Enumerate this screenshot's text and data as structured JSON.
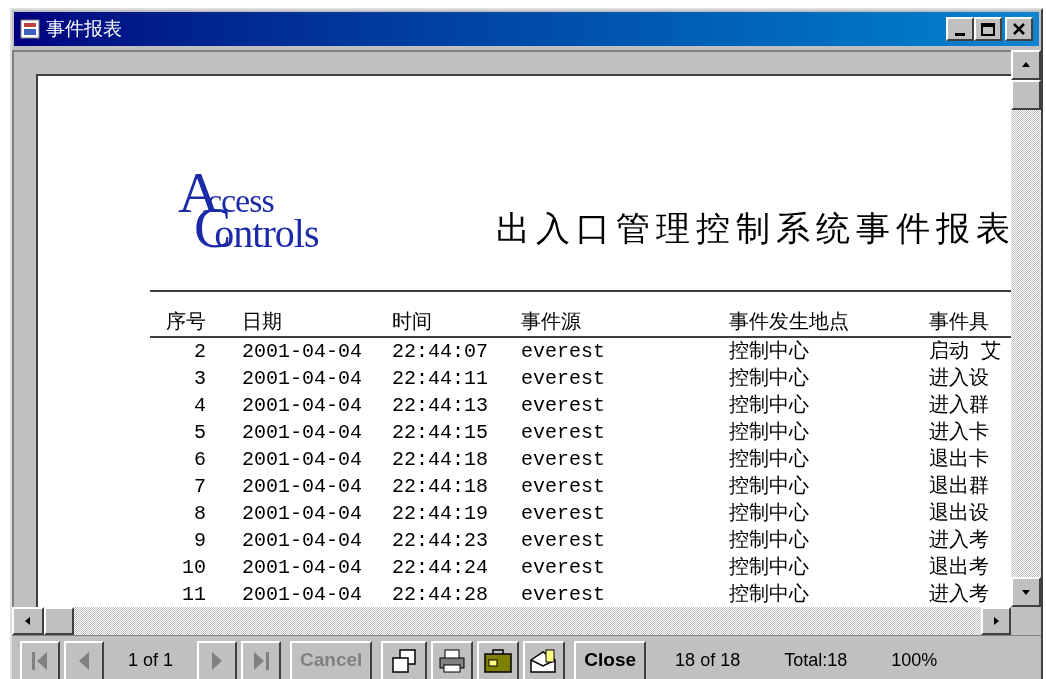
{
  "window": {
    "title": "事件报表"
  },
  "report": {
    "logo": {
      "line1": "Access",
      "line2": "Controls"
    },
    "title": "出入口管理控制系统事件报表",
    "columns": [
      "序号",
      "日期",
      "时间",
      "事件源",
      "事件发生地点",
      "事件具"
    ],
    "rows": [
      {
        "cells": [
          "2",
          "2001-04-04",
          "22:44:07",
          "everest",
          "控制中心",
          "启动 艾"
        ]
      },
      {
        "cells": [
          "3",
          "2001-04-04",
          "22:44:11",
          "everest",
          "控制中心",
          "进入设"
        ]
      },
      {
        "cells": [
          "4",
          "2001-04-04",
          "22:44:13",
          "everest",
          "控制中心",
          "进入群"
        ]
      },
      {
        "cells": [
          "5",
          "2001-04-04",
          "22:44:15",
          "everest",
          "控制中心",
          "进入卡"
        ]
      },
      {
        "cells": [
          "6",
          "2001-04-04",
          "22:44:18",
          "everest",
          "控制中心",
          "退出卡"
        ]
      },
      {
        "cells": [
          "7",
          "2001-04-04",
          "22:44:18",
          "everest",
          "控制中心",
          "退出群"
        ]
      },
      {
        "cells": [
          "8",
          "2001-04-04",
          "22:44:19",
          "everest",
          "控制中心",
          "退出设"
        ]
      },
      {
        "cells": [
          "9",
          "2001-04-04",
          "22:44:23",
          "everest",
          "控制中心",
          "进入考"
        ]
      },
      {
        "cells": [
          "10",
          "2001-04-04",
          "22:44:24",
          "everest",
          "控制中心",
          "退出考"
        ]
      },
      {
        "cells": [
          "11",
          "2001-04-04",
          "22:44:28",
          "everest",
          "控制中心",
          "进入考"
        ]
      }
    ]
  },
  "toolbar": [
    {
      "kind": "first",
      "disabled": true
    },
    {
      "kind": "prev",
      "disabled": true
    },
    {
      "kind": "label",
      "text": "1 of 1"
    },
    {
      "kind": "next",
      "disabled": true
    },
    {
      "kind": "last",
      "disabled": true
    },
    {
      "kind": "text_button",
      "text": "Cancel",
      "disabled": true
    },
    {
      "kind": "tree"
    },
    {
      "kind": "print"
    },
    {
      "kind": "export"
    },
    {
      "kind": "mail"
    },
    {
      "kind": "text_button",
      "text": "Close",
      "disabled": false
    },
    {
      "kind": "label",
      "text": "18 of 18"
    },
    {
      "kind": "label",
      "text": "Total:18"
    },
    {
      "kind": "label",
      "text": "100%"
    }
  ]
}
